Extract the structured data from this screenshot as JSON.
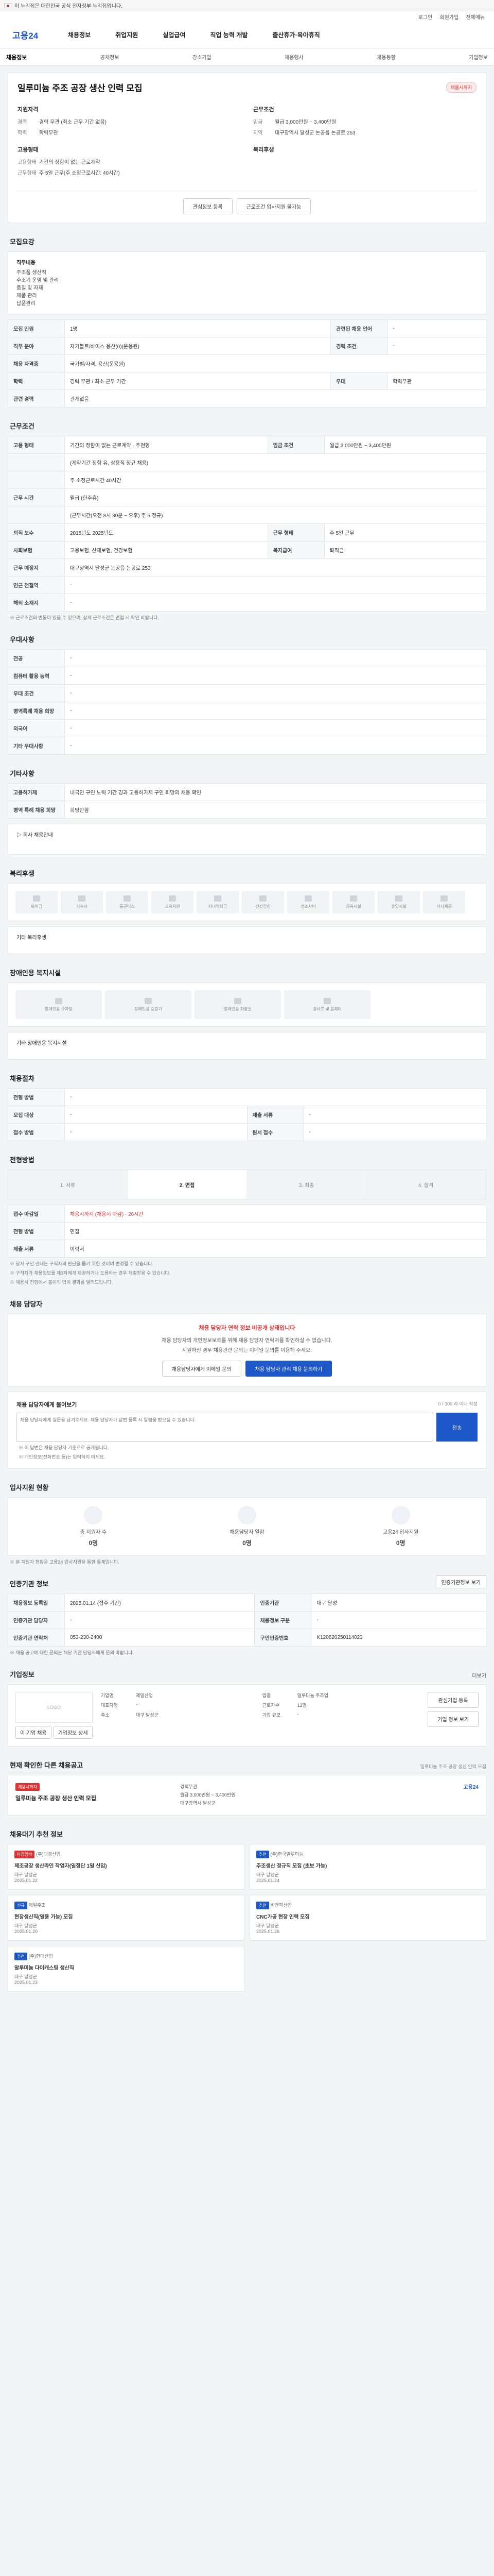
{
  "gov": {
    "text": "이 누리집은 대한민국 공식 전자정부 누리집입니다."
  },
  "util": {
    "login": "로그인",
    "join": "회원가입",
    "sitemap": "전체메뉴"
  },
  "gnb": {
    "logo": "고용24",
    "items": [
      "채용정보",
      "취업지원",
      "실업급여",
      "직업 능력 개발",
      "출산휴가·육아휴직"
    ]
  },
  "subnav": {
    "active": "채용정보",
    "items": [
      "공채정보",
      "강소기업",
      "채용행사",
      "채용동향",
      "기업정보"
    ]
  },
  "job": {
    "title": "일루미늄 주조 공장 생산 인력 모집",
    "status": "채용시까지",
    "req_title": "지원자격",
    "career_label": "경력",
    "career": "경력 무관 (최소 근무 기간 없음)",
    "edu_label": "학력",
    "edu": "학력무관",
    "form_title": "고용형태",
    "form_label": "고용형태",
    "form": "기간의 정함이 없는 근로계약",
    "hours_label": "근무형태",
    "hours": "주 5일 근무(주 소정근로시간: 40시간)",
    "cond_title": "근무조건",
    "pay_label": "임금",
    "pay": "월급 3,000만원 ~ 3,400만원",
    "loc_label": "지역",
    "loc": "대구광역시 달성군 논공읍 논공로 253",
    "benefit_title": "복리후생",
    "save_btn": "관심정보 등록",
    "share_btn": "근로조건 입사지원 불가능"
  },
  "sec_recruit": {
    "title": "모집요강",
    "content_label": "직무내용",
    "content": "주조품 생산직\n주조기 운영 및 관리\n품질 및 자재\n제품 관리\n납품관리",
    "rows": [
      [
        "모집 인원",
        "1명",
        "관련된 채용 언어",
        "-"
      ],
      [
        "직무 분야",
        "자기볼트/바이스 용산(0)(운용원)",
        "경력 조건",
        "-"
      ],
      [
        "채용 자격증",
        "국가별/자격, 용산(운용원)",
        "",
        ""
      ],
      [
        "학력",
        "경력 무관 / 최소 근무 기간",
        "우대",
        "학력무관"
      ],
      [
        "관련 경력",
        "관계없음",
        "",
        ""
      ]
    ]
  },
  "sec_cond": {
    "title": "근무조건",
    "rows": [
      [
        "고용 형태",
        "기간의 정함이 없는 근로계약 · 추천형",
        "임금 조건",
        "월급 3,000만원 ~ 3,400만원"
      ],
      [
        "",
        "(계약기간 정함 유, 상용직 정규 채용)",
        "",
        ""
      ],
      [
        "",
        "주 소정근로시간 40시간",
        "",
        ""
      ],
      [
        "근무 시간",
        "월급 (한주휴)",
        "",
        ""
      ],
      [
        "",
        "(근무시간(오전 8시 30분 ~ 오후) 주 5 정규)",
        "",
        ""
      ],
      [
        "퇴직 보수",
        "2015년도 2025년도",
        "근무 형태",
        "주 5일 근무"
      ],
      [
        "사회보험",
        "고용보험, 산재보험, 건강보험",
        "복지급여",
        "퇴직금"
      ],
      [
        "근무 예정지",
        "대구광역시 달성군 논공읍 논공로 253",
        "",
        ""
      ],
      [
        "인근 전철역",
        "-",
        "",
        ""
      ],
      [
        "해외 소재지",
        "-",
        "",
        ""
      ]
    ],
    "note": "※ 근로조건의 변동이 있을 수 있으며, 상세 근로조건은 면접 시 확인 바랍니다."
  },
  "sec_pref": {
    "title": "우대사항",
    "rows": [
      [
        "전공",
        "-"
      ],
      [
        "컴퓨터 활용 능력",
        "-"
      ],
      [
        "우대 조건",
        "-"
      ],
      [
        "병역특례 채용 희망",
        "-"
      ],
      [
        "외국어",
        "-"
      ],
      [
        "기타 우대사항",
        "-"
      ]
    ]
  },
  "sec_etc": {
    "title": "기타사항",
    "rows": [
      [
        "고용허가제",
        "내국인 구인 노력 기간 경과 고용허가제 구인 희망의 채용 확인"
      ],
      [
        "병역 특례 채용 희망",
        "희망안함"
      ]
    ],
    "sub": "▷ 회사 채용안내"
  },
  "sec_benefit": {
    "title": "복리후생",
    "icons": [
      "퇴직금",
      "기숙사",
      "통근버스",
      "교육지원",
      "자녀학자금",
      "건강검진",
      "경조사비",
      "체육시설",
      "휴양시설",
      "식사제공"
    ],
    "sub": "기타 복리후생"
  },
  "sec_disabled": {
    "title": "장애인용 복지시설",
    "icons": [
      "장애인용 주차장",
      "장애인용 승강기",
      "장애인용 화장실",
      "경사로 및 휠체어"
    ],
    "sub": "기타 장애인용 복지시설"
  },
  "sec_process": {
    "title": "채용절차",
    "rows": [
      [
        "전형 방법",
        "-"
      ],
      [
        "모집 대상",
        "-",
        "제출 서류",
        "-"
      ],
      [
        "접수 방법",
        "-",
        "원서 접수",
        "-"
      ]
    ]
  },
  "sec_steps": {
    "title": "전형방법",
    "steps": [
      "1. 서류",
      "2. 면접",
      "3. 최종",
      "4. 합격"
    ],
    "detail": [
      [
        "접수 마감일",
        "채용시까지 (채용시 마감) · 26시간"
      ],
      [
        "전형 방법",
        "면접"
      ],
      [
        "제출 서류",
        "이력서"
      ]
    ],
    "notes": [
      "※ 당사 구인 안내는 구직자의 판단을 돕기 위한 것이며 변경될 수 있습니다.",
      "※ 구직자가 채용정보를 제3자에게 제공하거나 도용하는 경우 처벌받을 수 있습니다.",
      "※ 채용시 전형에서 불이익 없이 결과를 알려드립니다."
    ]
  },
  "sec_contact": {
    "title": "채용 담당자",
    "alert": "채용 담당자 연락 정보 비공개 상태입니다",
    "desc": "채용 담당자의 개인정보보호를 위해 채용 담당자 연락처를 확인하실 수 없습니다.",
    "desc2": "지원하신 경우 채용관련 문의는 이메일 문의를 이용해 주세요.",
    "btn_email": "채용담당자에게 이메일 문의",
    "btn_map": "채용 담당자 관리 채용 문의하기"
  },
  "sec_qa": {
    "title": "채용 담당자에게 물어보기",
    "counter": "0 / 300 자 이내 작성",
    "placeholder": "채용 담당자에게 질문을 남겨주세요. 채용 담당자가 답변 등록 시 알림을 받으실 수 있습니다.",
    "submit": "전송",
    "notes": [
      "※ 이 답변은 채용 담당자 기준으로 공개됩니다.",
      "※ 개인정보(전화번호 등)는 입력하지 마세요."
    ]
  },
  "sec_stats": {
    "title": "입사지원 현황",
    "items": [
      [
        "총 지원자 수",
        "0명"
      ],
      [
        "채용담당자 열람",
        "0명"
      ],
      [
        "고용24 입사지원",
        "0명"
      ]
    ],
    "note": "※ 본 지원자 현황은 고용24 입사지원을 통한 통계입니다."
  },
  "sec_info": {
    "title": "인증기관 정보",
    "btn": "인증기관정보 보기",
    "rows": [
      [
        "채용정보 등록일",
        "2025.01.14 (접수 기간)",
        "인증기관",
        "대구 달성"
      ],
      [
        "인증기관 담당자",
        "-",
        "채용정보 구분",
        "-"
      ],
      [
        "인증기관 연락처",
        "053-230-2400",
        "구인인증번호",
        "K120620250114023"
      ]
    ],
    "note": "※ 채용 공고에 대한 문의는 해당 기관 담당자에게 문의 바랍니다."
  },
  "sec_company": {
    "title": "기업정보",
    "more": "더보기",
    "logo_text": "LOGO",
    "fields": [
      [
        "기업명",
        "제일산업"
      ],
      [
        "업종",
        "일루미늄 주조업"
      ],
      [
        "대표자명",
        "-"
      ],
      [
        "근로자수",
        "12명"
      ],
      [
        "주소",
        "대구 달성군"
      ],
      [
        "기업 규모",
        "-"
      ]
    ],
    "btn1": "관심기업 등록",
    "btn2": "기업 정보 보기",
    "btn_a": "이 기업 채용",
    "btn_b": "기업정보 상세"
  },
  "sec_similar": {
    "title": "현재 확인한 다른 채용공고",
    "note": "일루미늄 주조 공장 생산 인력 모집",
    "tag": "채용시까지",
    "name": "일루미늄 주조 공장 생산 인력 모집",
    "c1": "경력무관",
    "c2": "월급 3,000만원 ~ 3,400만원",
    "c3": "대구광역시 달성군",
    "side": "고용24"
  },
  "sec_other": {
    "title": "채용대기 추천 정보",
    "cards": [
      [
        "마감임박",
        "(주)대경산업",
        "제조공장 생산라인 작업자(일정단 1일 신입)",
        "대구 달성군",
        "2025.01.22"
      ],
      [
        "추천",
        "(주)한국알루미늄",
        "주조생산 정규직 모집 (초보 가능)",
        "대구 달성군",
        "2025.01.24"
      ],
      [
        "신규",
        "제일주조",
        "현장생산직(일용 가능) 모집",
        "대구 달성군",
        "2025.01.20"
      ],
      [
        "추천",
        "비엔피산업",
        "CNC가공 현장 인력 모집",
        "대구 달성군",
        "2025.01.26"
      ],
      [
        "추천",
        "(주)현대산업",
        "알루미늄 다이캐스팅 생산직",
        "대구 달성군",
        "2025.01.23"
      ]
    ]
  }
}
